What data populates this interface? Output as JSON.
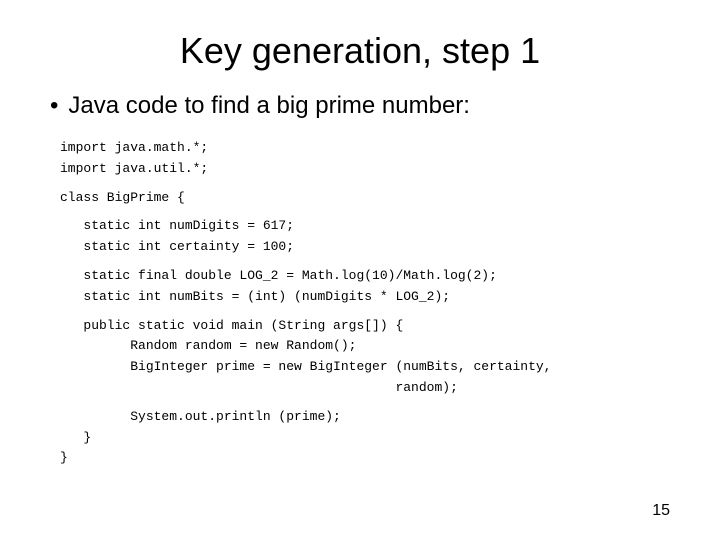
{
  "slide": {
    "title": "Key generation, step 1",
    "bullet": "Java code to find a big prime number:",
    "page_number": "15",
    "code": {
      "imports": [
        "import java.math.*;",
        "import java.util.*;"
      ],
      "class_decl": "class BigPrime {",
      "statics_1": [
        "   static int numDigits = 617;",
        "   static int certainty = 100;"
      ],
      "statics_2": [
        "   static final double LOG_2 = Math.log(10)/Math.log(2);",
        "   static int numBits = (int) (numDigits * LOG_2);"
      ],
      "main": [
        "   public static void main (String args[]) {",
        "         Random random = new Random();",
        "         BigInteger prime = new BigInteger (numBits, certainty,",
        "                                           random);",
        "",
        "         System.out.println (prime);",
        "   }",
        "}"
      ]
    }
  }
}
